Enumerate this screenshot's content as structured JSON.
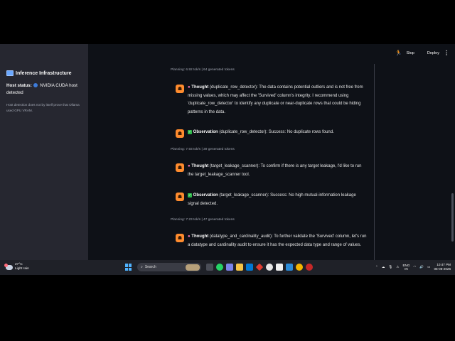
{
  "sidebar": {
    "title": "Inference Infrastructure",
    "host_label": "Host status:",
    "host_value": "NVIDIA CUDA host detected",
    "note": "Host detection does not by itself prove that Ollama used GPU VRAM."
  },
  "topbar": {
    "stop_label": "Stop",
    "deploy_label": "Deploy"
  },
  "chat": {
    "plan1": "Planning: 6.92 tok/s | 64 generated tokens",
    "thought1_label": "Thought",
    "thought1_text": " (duplicate_row_detector): The data contains potential outliers and is not free from missing values, which may affect the 'Survived' column's integrity. I recommend using 'duplicate_row_detector' to identify any duplicate or near-duplicate rows that could be hiding patterns in the data.",
    "obs1_label": "Observation",
    "obs1_text": " (duplicate_row_detector): Success: No duplicate rows found.",
    "plan2": "Planning: 7.93 tok/s | 39 generated tokens",
    "thought2_label": "Thought",
    "thought2_text": " (target_leakage_scanner): To confirm if there is any target leakage, I'd like to run the target_leakage_scanner tool.",
    "obs2_label": "Observation",
    "obs2_text": " (target_leakage_scanner): Success: No high mutual-information leakage signal detected.",
    "plan3": "Planning: 7.23 tok/s | 47 generated tokens",
    "thought3_label": "Thought",
    "thought3_text": " (datatype_and_cardinality_audit): To further validate the 'Survived' column, let's run a datatype and cardinality audit to ensure it has the expected data type and range of values."
  },
  "taskbar": {
    "temp": "27°C",
    "weather": "Light rain",
    "search_label": "Search",
    "lang_line1": "ENG",
    "lang_line2": "IN",
    "time": "10:47 PM",
    "date": "05-08-2026"
  },
  "colors": {
    "accent": "#ff8c2e",
    "sidebar_bg": "#262730",
    "main_bg": "#0e1117"
  }
}
